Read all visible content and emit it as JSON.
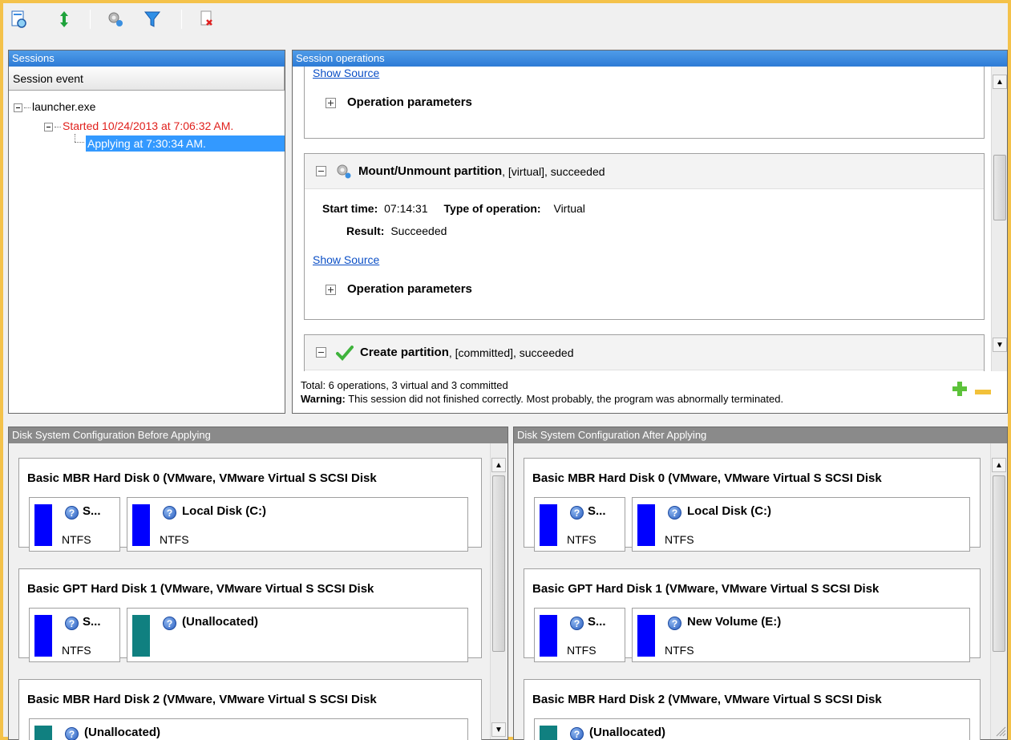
{
  "toolbar": {
    "buttons": [
      {
        "name": "open-session-icon"
      },
      {
        "name": "expand-collapse-icon"
      },
      {
        "name": "settings-icon"
      },
      {
        "name": "filter-icon"
      },
      {
        "name": "delete-icon"
      }
    ]
  },
  "sessions": {
    "header": "Sessions",
    "column_header": "Session event",
    "tree": {
      "root": "launcher.exe",
      "child": "Started 10/24/2013 at 7:06:32 AM.",
      "grandchild": "Applying at 7:30:34 AM."
    }
  },
  "operations": {
    "header": "Session operations",
    "card1": {
      "show_source": "Show Source",
      "params": "Operation parameters"
    },
    "card2": {
      "title_bold": "Mount/Unmount partition",
      "title_rest": ", [virtual], succeeded",
      "start_time_label": "Start time:",
      "start_time_value": "07:14:31",
      "type_label": "Type of operation:",
      "type_value": "Virtual",
      "result_label": "Result:",
      "result_value": "Succeeded",
      "show_source": "Show Source",
      "params": "Operation parameters"
    },
    "card3": {
      "title_bold": "Create partition",
      "title_rest": ", [committed], succeeded"
    },
    "footer": {
      "total": "Total: 6 operations, 3 virtual and 3 committed",
      "warning_label": "Warning:",
      "warning_text": " This session did not finished correctly. Most probably, the program was abnormally terminated."
    }
  },
  "before": {
    "header": "Disk System Configuration Before Applying",
    "disks": [
      {
        "title": "Basic MBR Hard Disk 0 (VMware, VMware Virtual S SCSI Disk",
        "small_name": "S...",
        "small_fs": "NTFS",
        "big_name": "Local Disk (C:)",
        "big_fs": "NTFS"
      },
      {
        "title": "Basic GPT Hard Disk 1 (VMware, VMware Virtual S SCSI Disk",
        "small_name": "S...",
        "small_fs": "NTFS",
        "big_name": "(Unallocated)",
        "big_fs": ""
      },
      {
        "title": "Basic MBR Hard Disk 2 (VMware, VMware Virtual S SCSI Disk",
        "big_name": "(Unallocated)"
      }
    ]
  },
  "after": {
    "header": "Disk System Configuration After Applying",
    "disks": [
      {
        "title": "Basic MBR Hard Disk 0 (VMware, VMware Virtual S SCSI Disk",
        "small_name": "S...",
        "small_fs": "NTFS",
        "big_name": "Local Disk (C:)",
        "big_fs": "NTFS"
      },
      {
        "title": "Basic GPT Hard Disk 1 (VMware, VMware Virtual S SCSI Disk",
        "small_name": "S...",
        "small_fs": "NTFS",
        "big_name": "New Volume (E:)",
        "big_fs": "NTFS"
      },
      {
        "title": "Basic MBR Hard Disk 2 (VMware, VMware Virtual S SCSI Disk",
        "big_name": "(Unallocated)"
      }
    ]
  },
  "colors": {
    "header_blue": "#2d7bd6",
    "selection": "#3399ff",
    "started_red": "#e0201c",
    "ntfs_blue": "#0000ff",
    "unallocated_teal": "#108080",
    "link": "#0b4fc6"
  },
  "icons": {
    "add": "plus-icon",
    "remove": "minus-icon",
    "help": "?"
  }
}
